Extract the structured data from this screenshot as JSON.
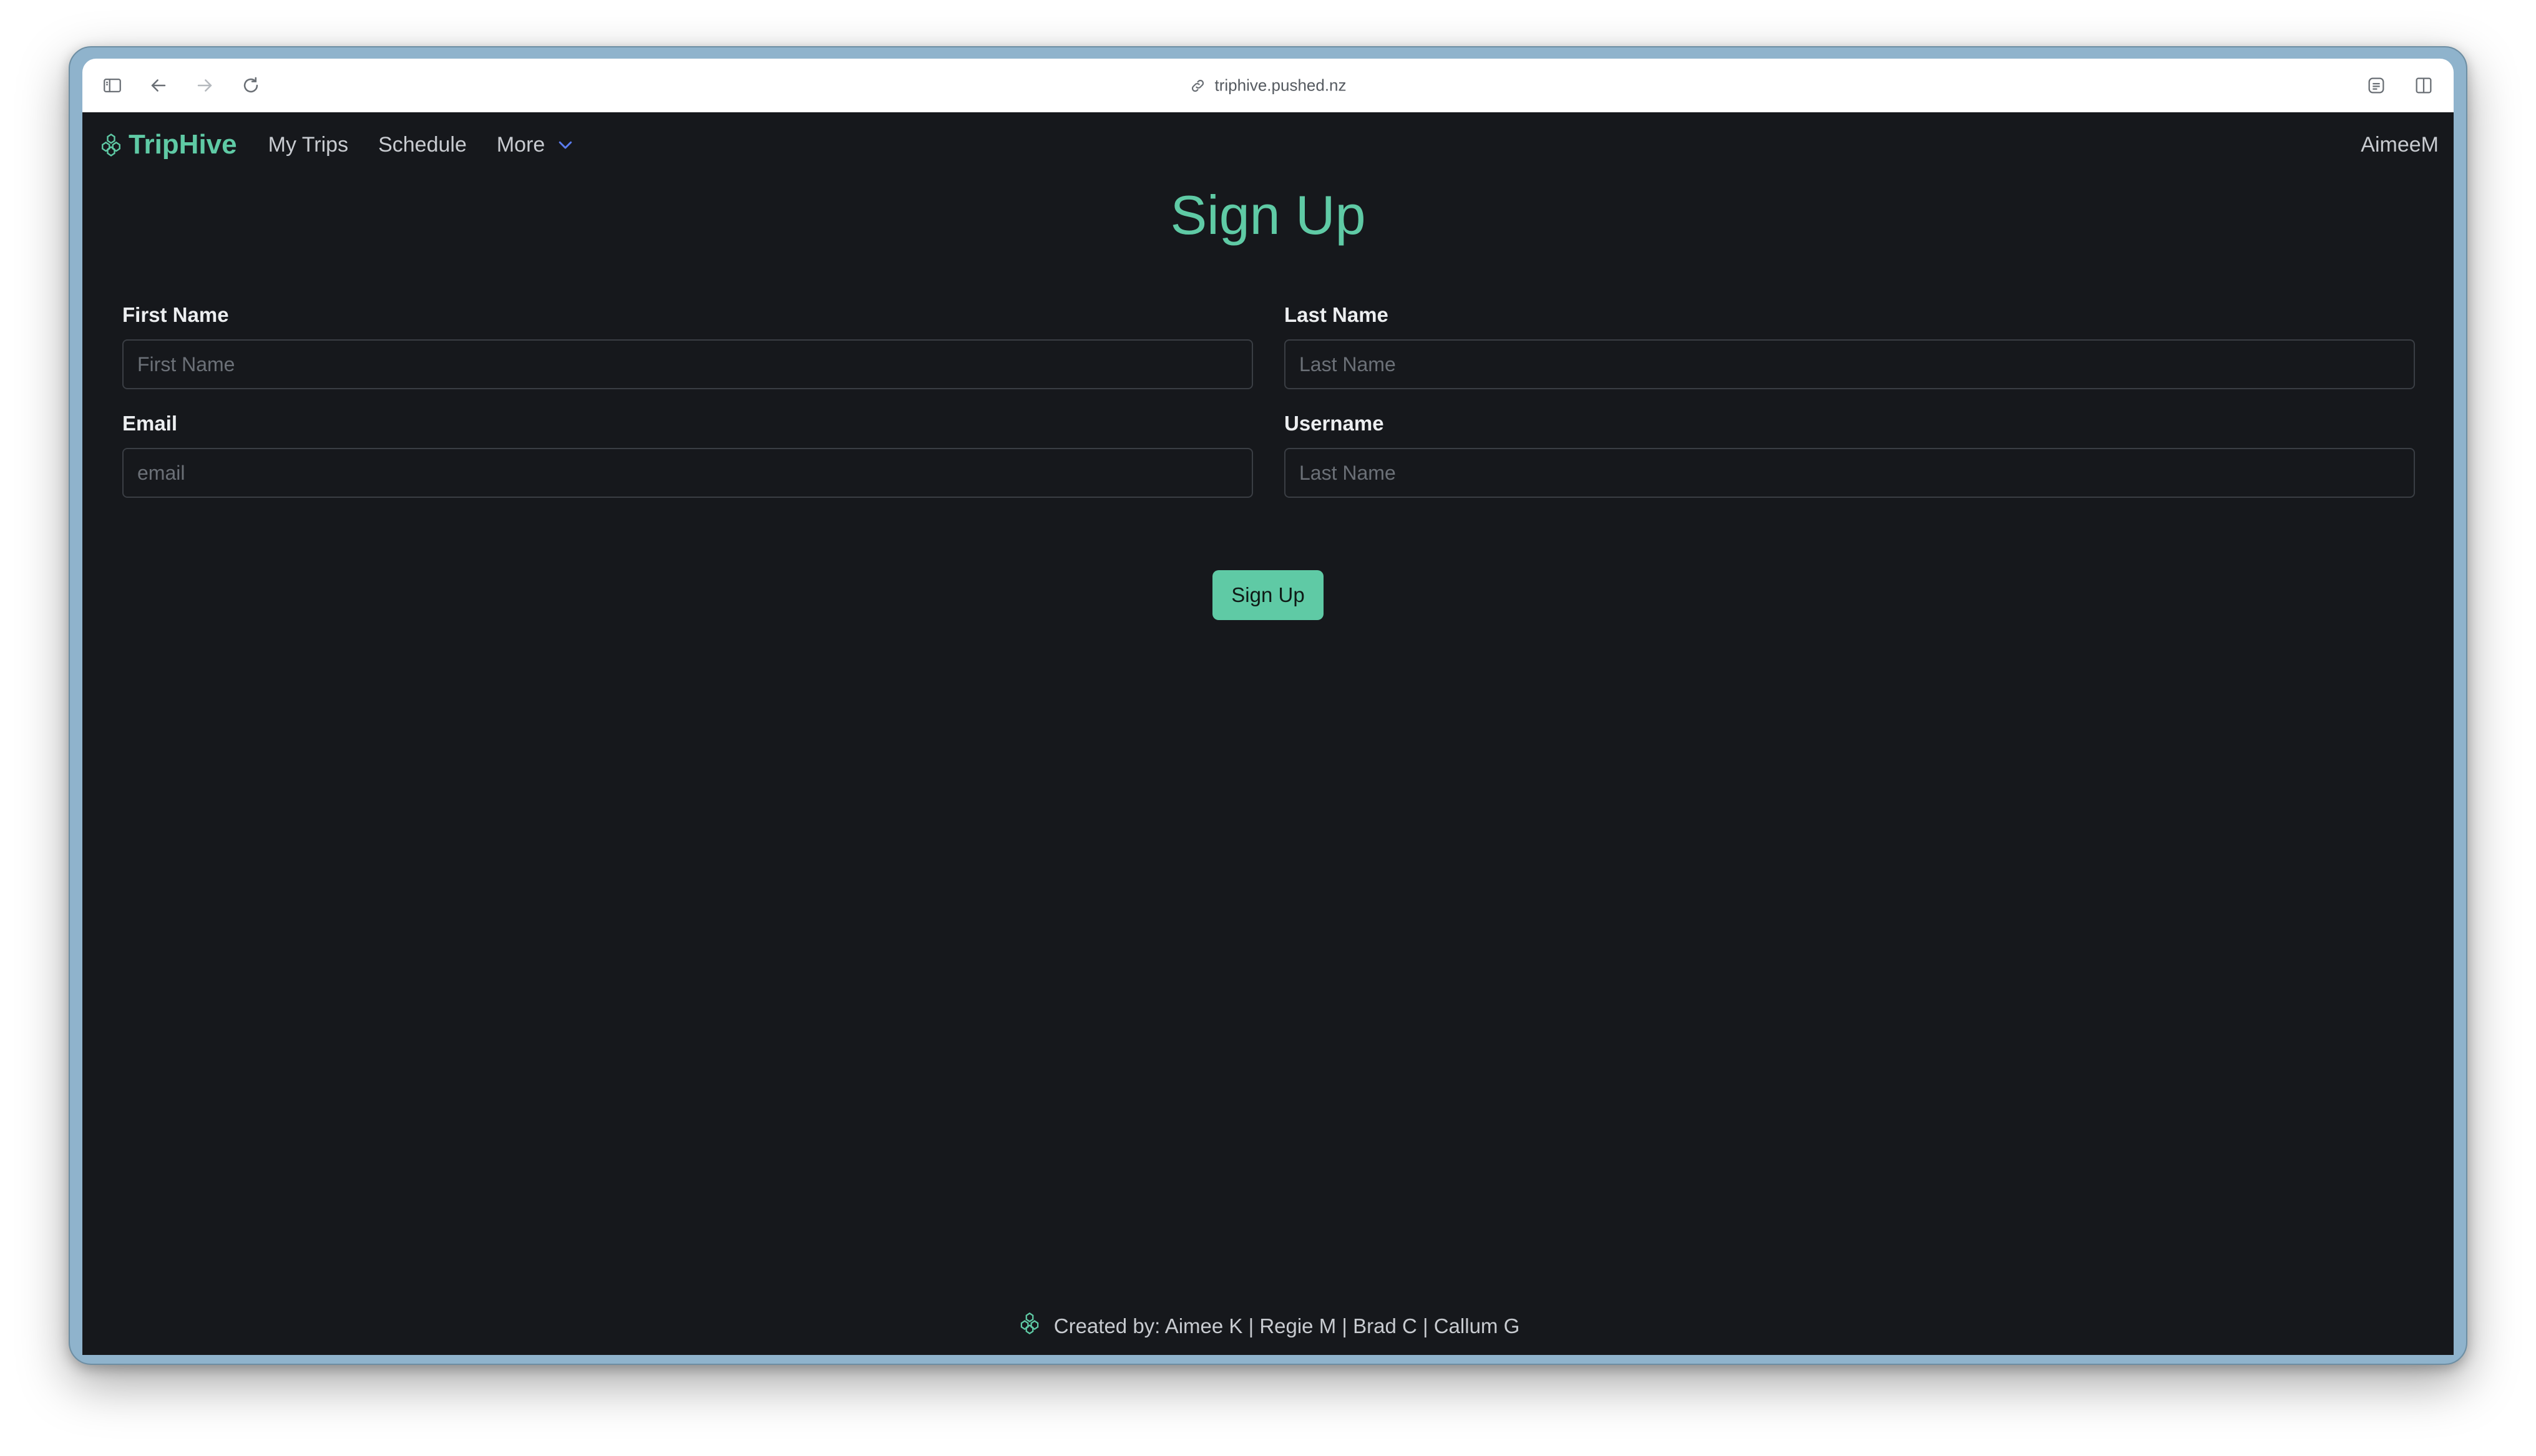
{
  "browser": {
    "url": "triphive.pushed.nz",
    "icons": [
      "sidebar-icon",
      "back-arrow-icon",
      "forward-arrow-icon",
      "reload-icon",
      "link-icon",
      "reader-icon",
      "split-view-icon"
    ]
  },
  "nav": {
    "brand": "TripHive",
    "links": [
      "My Trips",
      "Schedule",
      "More"
    ],
    "user": "AimeeM"
  },
  "page": {
    "title": "Sign Up"
  },
  "form": {
    "first_name": {
      "label": "First Name",
      "placeholder": "First Name",
      "value": ""
    },
    "last_name": {
      "label": "Last Name",
      "placeholder": "Last Name",
      "value": ""
    },
    "email": {
      "label": "Email",
      "placeholder": "email",
      "value": ""
    },
    "username": {
      "label": "Username",
      "placeholder": "Last Name",
      "value": ""
    },
    "submit_label": "Sign Up"
  },
  "footer": {
    "credits": "Created by: Aimee K | Regie M | Brad C | Callum G"
  },
  "colors": {
    "accent": "#5fcaa5",
    "background": "#16181c",
    "input_border": "#3a3e44",
    "chevron": "#5b7cf0"
  }
}
